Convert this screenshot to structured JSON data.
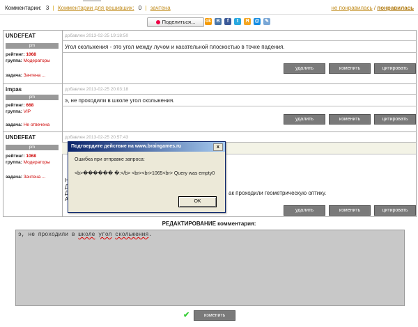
{
  "topbar": {
    "comments_label": "Комментарии:",
    "comments_count": "3",
    "solvers_link": "Комментарии для решивших:",
    "solvers_count": "0",
    "credited_link": "зачтена",
    "dislike_link": "не понравилась",
    "slash": "/",
    "like_link": "понравилась"
  },
  "share": {
    "label": "Поделиться...",
    "icons": [
      "odnoklassniki-icon",
      "vkontakte-icon",
      "facebook-icon",
      "twitter-icon",
      "yandex-icon",
      "mailru-icon",
      "livejournal-icon"
    ]
  },
  "comments": [
    {
      "user": "UNDEFEAT",
      "pm": "pm",
      "date": "добавлен 2013-02-25 19:18:50",
      "rating_label": "рейтинг:",
      "rating": "1068",
      "group_label": "группа:",
      "group": "Модераторы",
      "task_label": "задача:",
      "task": "Зачтена ...",
      "text": "Угол скольжения - это угол между лучом и касательной плоскостью в точке падения."
    },
    {
      "user": "impas",
      "pm": "pm",
      "date": "добавлен 2013-02-25 20:03:18",
      "rating_label": "рейтинг:",
      "rating": "668",
      "group_label": "группа:",
      "group": "VIP",
      "task_label": "задача:",
      "task": "Не отвечена",
      "text": "э, не проходили в школе угол скольжения."
    },
    {
      "user": "UNDEFEAT",
      "pm": "pm",
      "date": "добавлен 2013-02-25 20:57:43",
      "rating_label": "рейтинг:",
      "rating": "1068",
      "group_label": "группа:",
      "group": "Модераторы",
      "task_label": "задача:",
      "task": "Зачтена ...",
      "text": "",
      "partial": [
        "Н",
        "Д",
        "Д",
        "А"
      ],
      "partial_tail": "ак проходили геометрическую оптику."
    }
  ],
  "buttons": {
    "delete": "удалить",
    "edit": "изменить",
    "quote": "цитировать"
  },
  "edit_section": {
    "title": "РЕДАКТИРОВАНИЕ комментария:",
    "text_before": "э, не проходили в ",
    "w1": "школе",
    "sp1": " ",
    "w2": "угол",
    "sp2": " ",
    "w3": "скольжения",
    "text_after": ".",
    "submit": "изменить"
  },
  "dialog": {
    "title": "Подтвердите действие на www.braingames.ru",
    "close": "x",
    "message": "Ошибка при отправке запроса:",
    "body": "<b>������ �:</b> <br><br>1065<br> Query was empty0",
    "ok": "OK"
  },
  "colors": {
    "link": "#c28d1e",
    "red": "#cc0000",
    "button": "#7a7a7a",
    "dialog_title": "#0a246a"
  }
}
